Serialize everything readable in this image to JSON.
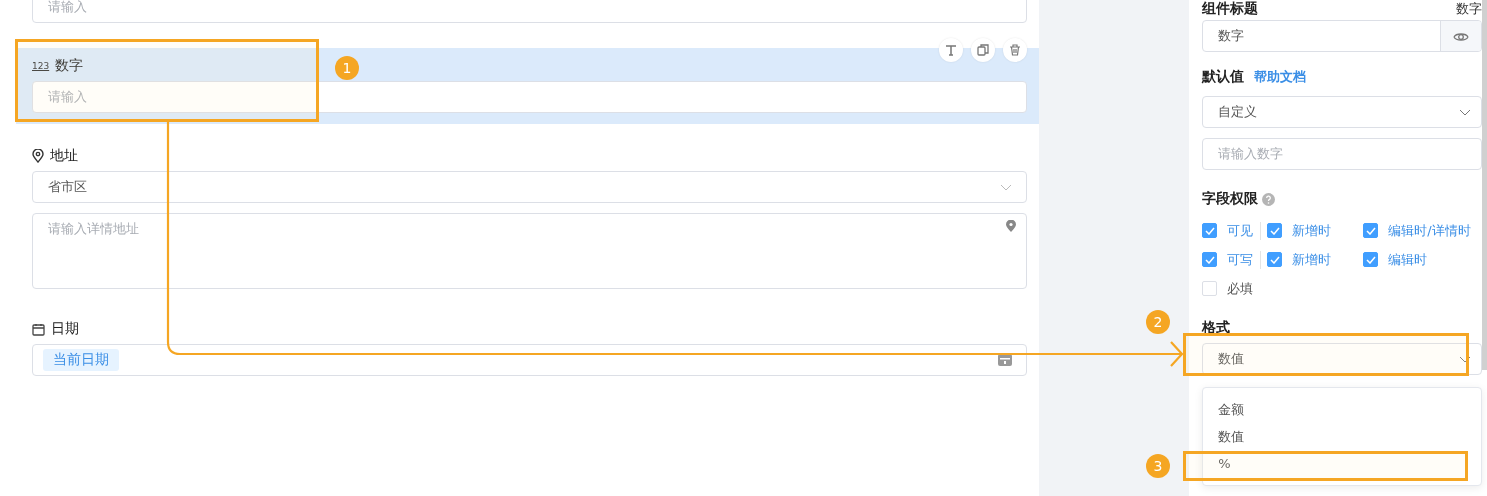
{
  "canvas": {
    "fields": [
      {
        "kind": "text",
        "placeholder": "请输入",
        "selected": false
      },
      {
        "kind": "number",
        "icon_text": "123",
        "label": "数字",
        "placeholder": "请输入",
        "selected": true
      },
      {
        "kind": "address",
        "label": "地址",
        "region": "省市区",
        "detail_placeholder": "请输入详情地址",
        "selected": false
      },
      {
        "kind": "date",
        "label": "日期",
        "tag": "当前日期",
        "selected": false
      }
    ]
  },
  "properties": {
    "title_label": "组件标题",
    "title_value": "数字",
    "title_input": "数字",
    "default_label": "默认值",
    "help_link": "帮助文档",
    "default_select": "自定义",
    "default_placeholder": "请输入数字",
    "permission_label": "字段权限",
    "permission_rows": [
      [
        {
          "label": "可见",
          "checked": true
        },
        {
          "label": "新增时",
          "checked": true
        },
        {
          "label": "编辑时/详情时",
          "checked": true
        }
      ],
      [
        {
          "label": "可写",
          "checked": true
        },
        {
          "label": "新增时",
          "checked": true
        },
        {
          "label": "编辑时",
          "checked": true
        }
      ]
    ],
    "required": {
      "label": "必填",
      "checked": false
    },
    "format_label": "格式",
    "format_value": "数值",
    "format_options": [
      "金额",
      "数值",
      "%"
    ]
  },
  "annotations": [
    {
      "label": "1"
    },
    {
      "label": "2"
    },
    {
      "label": "3"
    }
  ]
}
